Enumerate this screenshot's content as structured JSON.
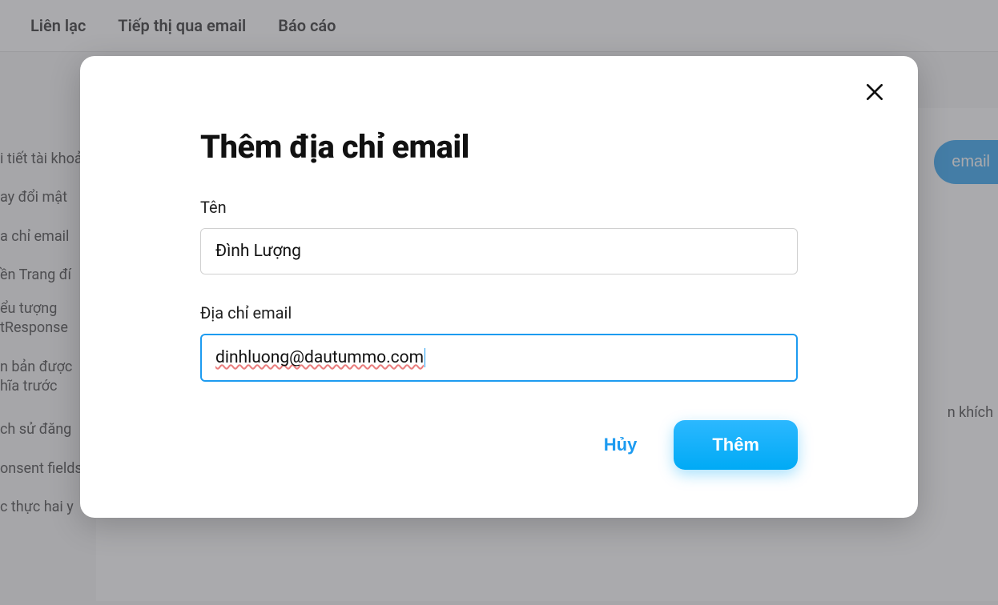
{
  "topnav": {
    "items": [
      "Liên lạc",
      "Tiếp thị qua email",
      "Báo cáo"
    ]
  },
  "sidebar": {
    "items": [
      "i tiết tài khoản",
      "ay đổi mật",
      "a chỉ email",
      "ền Trang đí",
      "ểu tượng\ntResponse",
      "n bản được\nhĩa trước",
      "ch sử đăng",
      "onsent fields",
      "c thực hai y"
    ]
  },
  "main": {
    "button_partial": "email",
    "label_partial": "n khích"
  },
  "modal": {
    "title": "Thêm địa chỉ email",
    "name_label": "Tên",
    "name_value": "Đình Lượng",
    "email_label": "Địa chỉ email",
    "email_value": "dinhluong@dautummo.com",
    "cancel": "Hủy",
    "submit": "Thêm"
  }
}
